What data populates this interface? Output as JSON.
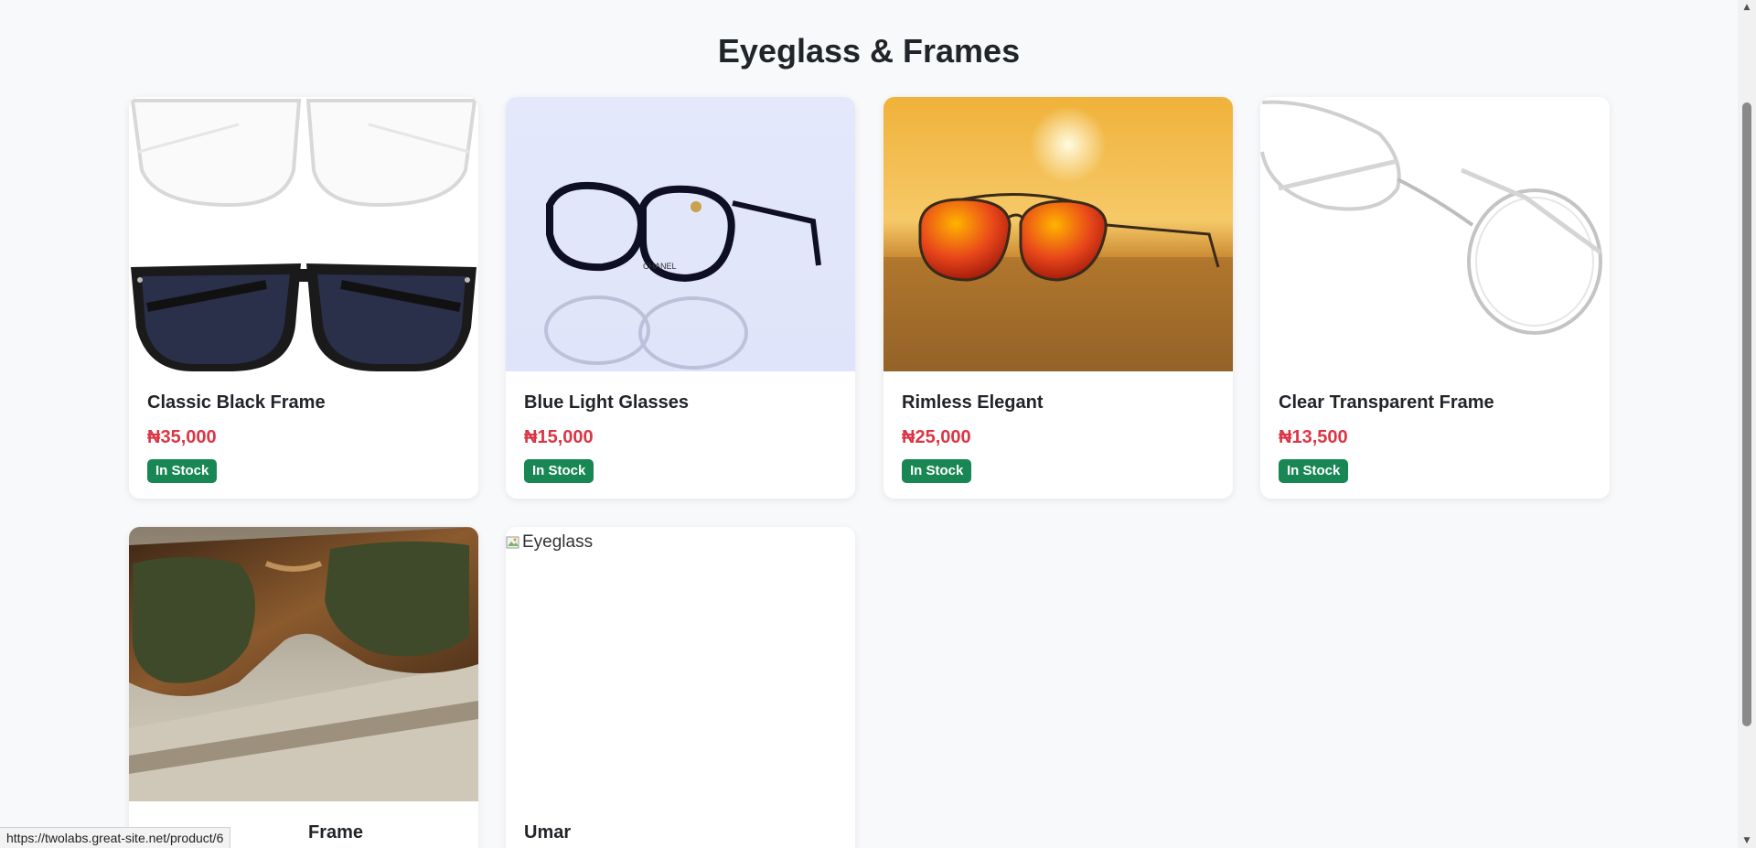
{
  "page": {
    "title": "Eyeglass & Frames"
  },
  "products": [
    {
      "name": "Classic Black Frame",
      "price": "₦35,000",
      "stock": "In Stock",
      "image": "clear-and-black-frames-photo"
    },
    {
      "name": "Blue Light Glasses",
      "price": "₦15,000",
      "stock": "In Stock",
      "image": "black-chanel-glasses-photo",
      "brand_mark": "CHANEL"
    },
    {
      "name": "Rimless Elegant",
      "price": "₦25,000",
      "stock": "In Stock",
      "image": "aviator-sunglasses-on-beach-photo"
    },
    {
      "name": "Clear Transparent Frame",
      "price": "₦13,500",
      "stock": "In Stock",
      "image": "clear-round-frames-photo"
    },
    {
      "name": "Frame",
      "image": "tortoise-sunglasses-photo"
    },
    {
      "name": "Umar",
      "image_alt": "Eyeglass",
      "image": "broken-image"
    }
  ],
  "status_bar": {
    "url": "https://twolabs.great-site.net/product/6"
  },
  "colors": {
    "price": "#dc3545",
    "badge": "#198754",
    "background": "#f8f9fa"
  }
}
